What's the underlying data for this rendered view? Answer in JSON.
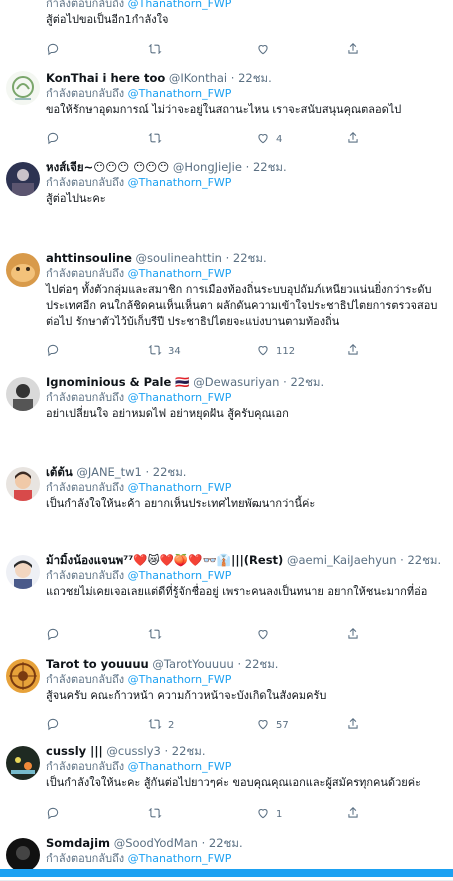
{
  "replying_prefix": "กำลังตอบกลับถึง",
  "tweets": [
    {
      "name": "",
      "handle": "",
      "time": "",
      "replying_to": "@Thanathorn_FWP",
      "text": "สู้ต่อไปขอเป็นอีก1กำลังใจ",
      "reply_count": "",
      "retweet_count": "",
      "like_count": ""
    },
    {
      "name": "KonThai i here too",
      "handle": "@IKonthai",
      "time": "22ชม.",
      "replying_to": "@Thanathorn_FWP",
      "text": "ขอให้รักษาอุดมการณ์ ไม่ว่าจะอยู่ในสถานะไหน เราจะสนับสนุนคุณตลอดไป",
      "reply_count": "",
      "retweet_count": "",
      "like_count": "4"
    },
    {
      "name": "หงส์เจีย~😶😶😶 😶😶😶",
      "handle": "@HongJieJie",
      "time": "22ชม.",
      "replying_to": "@Thanathorn_FWP",
      "text": "สู้ต่อไปนะคะ",
      "reply_count": "",
      "retweet_count": "",
      "like_count": ""
    },
    {
      "name": "ahttinsouline",
      "handle": "@soulineahttin",
      "time": "22ชม.",
      "replying_to": "@Thanathorn_FWP",
      "text": "ไปต่อๆ ทั้งตัวกลุ่มและสมาชิก การเมืองท้องถิ่นระบบอุปถัมภ์เหนียวแน่นยิ่งกว่าระดับประเทศอีก คนใกล้ชิดคนเห็นเห็นตา ผลักดันความเข้าใจประชาธิปไตยการตรวจสอบต่อไป รักษาตัวไว้บ้เก็บรีปี ประชาธิปไตยจะแบ่งบานตามท้องถิ่น",
      "reply_count": "",
      "retweet_count": "34",
      "like_count": "112"
    },
    {
      "name": "Ignominious & Pale 🇹🇭",
      "handle": "@Dewasuriyan",
      "time": "22ชม.",
      "replying_to": "@Thanathorn_FWP",
      "text": "อย่าเปลี่ยนใจ อย่าหมดไฟ อย่าหยุดฝัน สู้ครับคุณเอก",
      "reply_count": "",
      "retweet_count": "",
      "like_count": ""
    },
    {
      "name": "เต้ต้น",
      "handle": "@JANE_tw1",
      "time": "22ชม.",
      "replying_to": "@Thanathorn_FWP",
      "text": "เป็นกำลังใจให้นะค้า อยากเห็นประเทศไทยพัฒนากว่านี้ค่ะ",
      "reply_count": "",
      "retweet_count": "",
      "like_count": ""
    },
    {
      "name": "ม้ามิ้งน้องแจนพ⁷⁷❤️😿❤️🍑❤️👓👔|||(Rest)",
      "handle": "@aemi_KaiJaehyun",
      "time": "22ชม.",
      "replying_to": "@Thanathorn_FWP",
      "text": "แถวชยไม่เคยเจอเลยแต่ดีที่รู้จักชื่ออยู่ เพราะคนลงเป็นทนาย อยากให้ชนะมากที่อ่อ",
      "reply_count": "",
      "retweet_count": "",
      "like_count": ""
    },
    {
      "name": "Tarot to youuuu",
      "handle": "@TarotYouuuu",
      "time": "22ชม.",
      "replying_to": "@Thanathorn_FWP",
      "text": "สู้จนครับ คณะก้าวหน้า ความก้าวหน้าจะบังเกิดในสังคมครับ",
      "reply_count": "",
      "retweet_count": "2",
      "like_count": "57"
    },
    {
      "name": "cussly |||",
      "handle": "@cussly3",
      "time": "22ชม.",
      "replying_to": "@Thanathorn_FWP",
      "text": "เป็นกำลังใจให้นะคะ สู้กันต่อไปยาวๆค่ะ ขอบคุณคุณเอกและผู้สมัครทุกคนด้วยค่ะ",
      "reply_count": "",
      "retweet_count": "",
      "like_count": "1"
    },
    {
      "name": "Somdajim",
      "handle": "@SoodYodMan",
      "time": "22ชม.",
      "replying_to": "@Thanathorn_FWP",
      "text": "",
      "reply_count": "",
      "retweet_count": "",
      "like_count": ""
    }
  ],
  "colors": {
    "accent": "#1da1f2",
    "muted": "#5b7083",
    "border": "#e6ecf0"
  },
  "icons": {
    "reply": "reply-icon",
    "retweet": "retweet-icon",
    "like": "heart-icon",
    "share": "share-icon"
  }
}
